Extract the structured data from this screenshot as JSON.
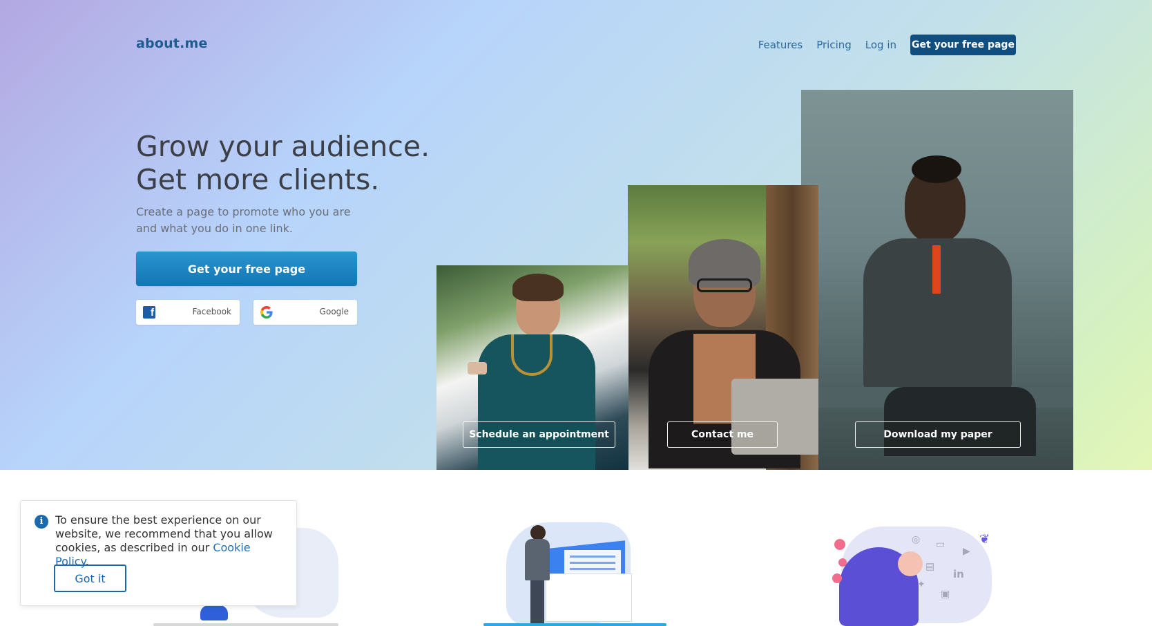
{
  "header": {
    "logo": "about.me",
    "nav": {
      "features": "Features",
      "pricing": "Pricing",
      "login": "Log in",
      "cta": "Get your free page"
    }
  },
  "hero": {
    "headline_line1": "Grow your audience.",
    "headline_line2": "Get more clients.",
    "subhead": "Create a page to promote who you are and what you do in one link.",
    "cta": "Get your free page",
    "social": {
      "facebook": "Facebook",
      "google": "Google"
    },
    "cards": [
      {
        "button": "Schedule an appointment"
      },
      {
        "button": "Contact me"
      },
      {
        "button": "Download my paper"
      }
    ]
  },
  "cookie_banner": {
    "message": "To ensure the best experience on our website, we recommend that you allow cookies, as described in our ",
    "link": "Cookie Policy",
    "suffix": ".",
    "button": "Got it"
  },
  "colors": {
    "brand_dark": "#104e7f",
    "cta_blue": "#1b84c2",
    "link_blue": "#1c6fb4"
  }
}
